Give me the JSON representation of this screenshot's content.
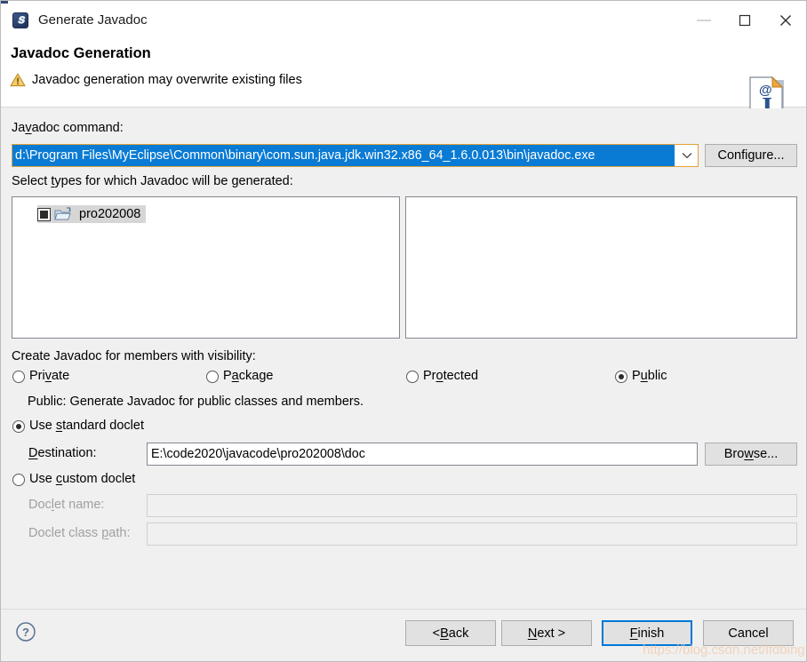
{
  "window": {
    "title": "Generate Javadoc",
    "app_icon": "myeclipse-icon",
    "controls": {
      "minimize": "minimize-icon",
      "maximize": "maximize-icon",
      "close": "close-icon"
    }
  },
  "header": {
    "title": "Javadoc Generation",
    "message": "Javadoc generation may overwrite existing files",
    "warning_icon": "warning-triangle-icon",
    "banner_icon": "javadoc-page-icon"
  },
  "command": {
    "label": "Javadoc command:",
    "label_mnemonic_prefix": "Ja",
    "label_mnemonic_char": "v",
    "label_mnemonic_suffix": "adoc command:",
    "value": "d:\\Program Files\\MyEclipse\\Common\\binary\\com.sun.java.jdk.win32.x86_64_1.6.0.013\\bin\\javadoc.exe",
    "selected": true,
    "dropdown_icon": "chevron-down-icon",
    "configure_label": "Configure..."
  },
  "types": {
    "label_prefix": "Select ",
    "label_mnemonic_char": "t",
    "label_suffix": "ypes for which Javadoc will be generated:",
    "tree_items": [
      {
        "label": "pro202008",
        "checkbox_state": "grayed",
        "icon": "java-project-folder-icon",
        "selected": true
      }
    ],
    "right_pane_items": []
  },
  "visibility": {
    "label": "Create Javadoc for members with visibility:",
    "options": [
      {
        "label_prefix": "Pri",
        "mnemonic": "v",
        "label_suffix": "ate",
        "full": "Private",
        "selected": false
      },
      {
        "label_prefix": "P",
        "mnemonic": "a",
        "label_suffix": "ckage",
        "full": "Package",
        "selected": false
      },
      {
        "label_prefix": "Pr",
        "mnemonic": "o",
        "label_suffix": "tected",
        "full": "Protected",
        "selected": false
      },
      {
        "label_prefix": "P",
        "mnemonic": "u",
        "label_suffix": "blic",
        "full": "Public",
        "selected": true
      }
    ],
    "description": "Public: Generate Javadoc for public classes and members."
  },
  "doclet": {
    "standard": {
      "label_prefix": "Use ",
      "mnemonic": "s",
      "label_suffix": "tandard doclet",
      "full": "Use standard doclet",
      "selected": true
    },
    "custom": {
      "label_prefix": "Use ",
      "mnemonic": "c",
      "label_suffix": "ustom doclet",
      "full": "Use custom doclet",
      "selected": false
    },
    "destination": {
      "label_prefix": "",
      "mnemonic": "D",
      "label_suffix": "estination:",
      "full": "Destination:",
      "value": "E:\\code2020\\javacode\\pro202008\\doc",
      "browse_label": "Browse...",
      "browse_mnemonic": "w",
      "enabled": true
    },
    "doclet_name": {
      "label_prefix": "Doc",
      "mnemonic": "l",
      "label_suffix": "et name:",
      "full": "Doclet name:",
      "value": "",
      "enabled": false
    },
    "doclet_class_path": {
      "label_prefix": "Doclet class ",
      "mnemonic": "p",
      "label_suffix": "ath:",
      "full": "Doclet class path:",
      "value": "",
      "enabled": false
    }
  },
  "footer": {
    "help_icon": "help-question-icon",
    "buttons": [
      {
        "label_prefix": "< ",
        "mnemonic": "B",
        "label_suffix": "ack",
        "full": "< Back",
        "default": false
      },
      {
        "label_prefix": "",
        "mnemonic": "N",
        "label_suffix": "ext >",
        "full": "Next >",
        "default": false
      },
      {
        "label_prefix": "",
        "mnemonic": "F",
        "label_suffix": "inish",
        "full": "Finish",
        "default": true
      },
      {
        "label_prefix": "",
        "mnemonic": "",
        "label_suffix": "Cancel",
        "full": "Cancel",
        "default": false
      }
    ]
  },
  "watermark": "https://blog.csdn.net/lfdbing",
  "colors": {
    "selection_blue": "#0a7bd4",
    "focus_blue": "#0078d7",
    "dialog_gray": "#f0f0f0",
    "field_border": "#828790",
    "combo_border": "#e2a33a",
    "disabled_text": "#a0a0a0"
  }
}
